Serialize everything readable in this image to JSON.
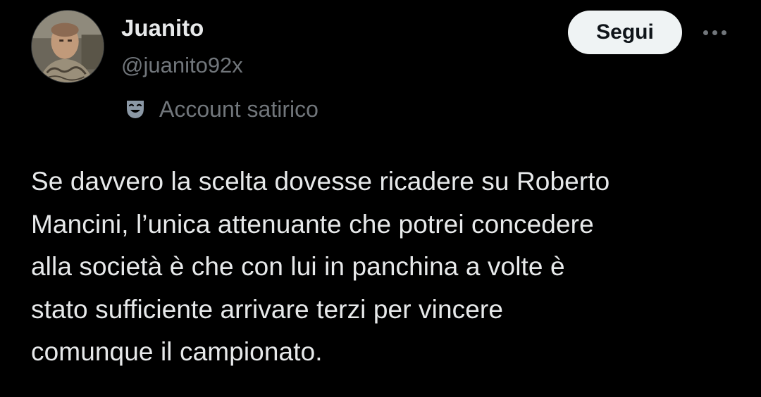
{
  "author": {
    "display_name": "Juanito",
    "handle": "@juanito92x",
    "avatar_alt": "profile photo"
  },
  "label": {
    "icon": "theater-mask-icon",
    "text": "Account satirico"
  },
  "actions": {
    "follow_label": "Segui",
    "more_icon": "more-horizontal-icon"
  },
  "tweet": {
    "lines": [
      "Se davvero la scelta dovesse ricadere su Roberto",
      "Mancini, l’unica attenuante che potrei concedere",
      "alla società è che con lui in panchina a volte è",
      "stato sufficiente arrivare terzi per vincere",
      "comunque il campionato."
    ]
  },
  "colors": {
    "background": "#000000",
    "primary_text": "#e7e9ea",
    "secondary_text": "#71767b",
    "button_bg": "#eff3f4",
    "button_text": "#0f1419"
  }
}
